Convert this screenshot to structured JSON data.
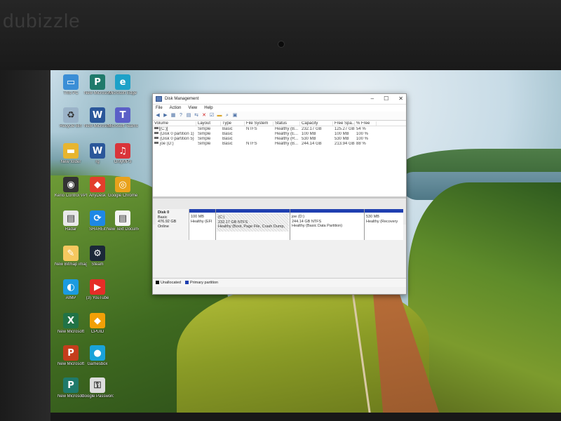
{
  "watermark": "dubizzle",
  "desktop_icons": [
    {
      "label": "This PC",
      "icon": "computer-icon",
      "color": "#3b8ed6",
      "glyph": "▭"
    },
    {
      "label": "New Microsoft",
      "icon": "publisher-icon",
      "color": "#1f7a6b",
      "glyph": "P"
    },
    {
      "label": "Microsoft Edge",
      "icon": "edge-icon",
      "color": "#1da1c8",
      "glyph": "e"
    },
    {
      "label": "Recycle Bin",
      "icon": "recycle-bin-icon",
      "color": "#9bb3c8",
      "glyph": "♻"
    },
    {
      "label": "New Microsoft",
      "icon": "word-icon",
      "color": "#2b579a",
      "glyph": "W"
    },
    {
      "label": "Microsoft Teams",
      "icon": "teams-icon",
      "color": "#5b5fc7",
      "glyph": "T"
    },
    {
      "label": "New folder",
      "icon": "folder-icon",
      "color": "#e8b52f",
      "glyph": "▬"
    },
    {
      "label": "rg",
      "icon": "word-icon",
      "color": "#2b579a",
      "glyph": "W"
    },
    {
      "label": "OnlyMP3",
      "icon": "onlymp3-icon",
      "color": "#d9343a",
      "glyph": "♫"
    },
    {
      "label": "Kerio Control VPN Client",
      "icon": "vpn-icon",
      "color": "#333333",
      "glyph": "◉"
    },
    {
      "label": "AnyDesk",
      "icon": "anydesk-icon",
      "color": "#e33e2b",
      "glyph": "◆"
    },
    {
      "label": "Google Chrome",
      "icon": "chrome-icon",
      "color": "#e9a21c",
      "glyph": "◎"
    },
    {
      "label": "Radar",
      "icon": "document-icon",
      "color": "#e9e9e9",
      "glyph": "▤"
    },
    {
      "label": "SHAREit",
      "icon": "shareit-icon",
      "color": "#1e88e5",
      "glyph": "⟳"
    },
    {
      "label": "New Text Document",
      "icon": "text-document-icon",
      "color": "#f4f4f4",
      "glyph": "▤"
    },
    {
      "label": "New Bitmap image",
      "icon": "paint-icon",
      "color": "#f6c85f",
      "glyph": "✎"
    },
    {
      "label": "Steam",
      "icon": "steam-icon",
      "color": "#1b2838",
      "glyph": "⚙"
    },
    {
      "label": "AIMP",
      "icon": "aimp-icon",
      "color": "#1b9be0",
      "glyph": "◐"
    },
    {
      "label": "(3) YouTube",
      "icon": "youtube-icon",
      "color": "#e52d27",
      "glyph": "▶"
    },
    {
      "label": "New Microsoft",
      "icon": "excel-icon",
      "color": "#217346",
      "glyph": "X"
    },
    {
      "label": "CPUID",
      "icon": "cpuid-icon",
      "color": "#f2a007",
      "glyph": "◆"
    },
    {
      "label": "New Microsoft",
      "icon": "powerpoint-icon",
      "color": "#c43e1c",
      "glyph": "P"
    },
    {
      "label": "Gamesbox",
      "icon": "gamesbox-icon",
      "color": "#1aa3d9",
      "glyph": "●"
    },
    {
      "label": "New Microsoft",
      "icon": "publisher-icon",
      "color": "#1f7a6b",
      "glyph": "P"
    },
    {
      "label": "Google Password",
      "icon": "key-icon",
      "color": "#dddddd",
      "glyph": "⚿"
    }
  ],
  "window": {
    "title": "Disk Management",
    "controls": {
      "minimize": "–",
      "maximize": "☐",
      "close": "✕"
    },
    "menu": [
      "File",
      "Action",
      "View",
      "Help"
    ],
    "columns": [
      "Volume",
      "Layout",
      "Type",
      "File System",
      "Status",
      "Capacity",
      "Free Spa...",
      "% Free"
    ],
    "volumes": [
      [
        "(C:)",
        "Simple",
        "Basic",
        "NTFS",
        "Healthy (B...",
        "232.17 GB",
        "125.27 GB",
        "54 %"
      ],
      [
        "(Disk 0 partition 1)",
        "Simple",
        "Basic",
        "",
        "Healthy (E...",
        "100 MB",
        "100 MB",
        "100 %"
      ],
      [
        "(Disk 0 partition 5)",
        "Simple",
        "Basic",
        "",
        "Healthy (R...",
        "530 MB",
        "530 MB",
        "100 %"
      ],
      [
        "joe (D:)",
        "Simple",
        "Basic",
        "NTFS",
        "Healthy (B...",
        "244.14 GB",
        "213.94 GB",
        "88 %"
      ]
    ],
    "disk": {
      "name": "Disk 0",
      "type": "Basic",
      "size": "476.92 GB",
      "state": "Online",
      "partitions": [
        {
          "name": "",
          "size": "100 MB",
          "status": "Healthy (EFI"
        },
        {
          "name": "(C:)",
          "size": "232.17 GB NTFS",
          "status": "Healthy (Boot, Page File, Crash Dump,"
        },
        {
          "name": "joe (D:)",
          "size": "244.14 GB NTFS",
          "status": "Healthy (Basic Data Partition)"
        },
        {
          "name": "",
          "size": "530 MB",
          "status": "Healthy (Recovery"
        }
      ]
    },
    "legend": {
      "unallocated": "Unallocated",
      "primary": "Primary partition"
    }
  },
  "colors": {
    "partition_bar": "#1f3fb0",
    "unallocated": "#111111"
  }
}
